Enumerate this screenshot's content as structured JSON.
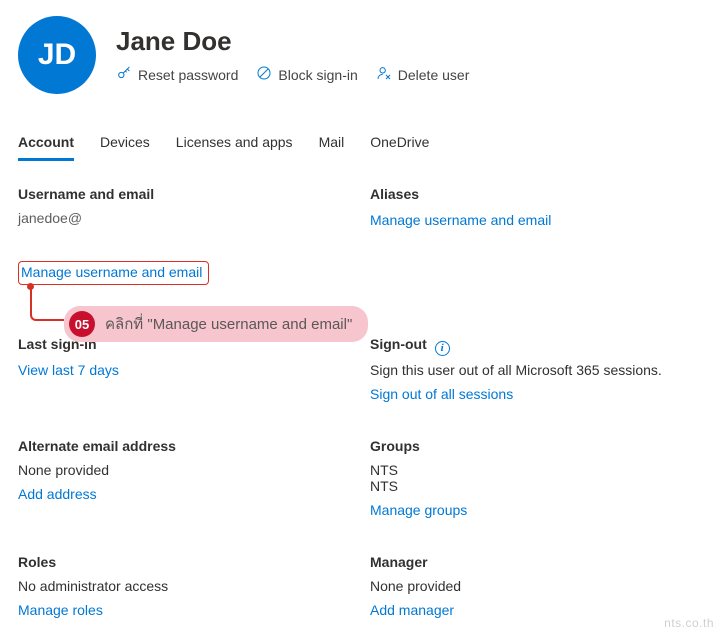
{
  "colors": {
    "primary": "#0078d4",
    "danger": "#d93025"
  },
  "user": {
    "initials": "JD",
    "display_name": "Jane Doe",
    "username_email": "janedoe@"
  },
  "header_actions": {
    "reset_password": "Reset password",
    "block_signin": "Block sign-in",
    "delete_user": "Delete user"
  },
  "tabs": {
    "account": "Account",
    "devices": "Devices",
    "licenses": "Licenses and apps",
    "mail": "Mail",
    "onedrive": "OneDrive",
    "active": "account"
  },
  "sections": {
    "username_email": {
      "heading": "Username and email",
      "link": "Manage username and email"
    },
    "aliases": {
      "heading": "Aliases",
      "link": "Manage username and email"
    },
    "last_signin": {
      "heading": "Last sign-in",
      "link": "View last 7 days"
    },
    "sign_out": {
      "heading": "Sign-out",
      "desc": "Sign this user out of all Microsoft 365 sessions.",
      "link": "Sign out of all sessions"
    },
    "alt_email": {
      "heading": "Alternate email address",
      "value": "None provided",
      "link": "Add address"
    },
    "groups": {
      "heading": "Groups",
      "items": [
        "NTS",
        "NTS"
      ],
      "link": "Manage groups"
    },
    "roles": {
      "heading": "Roles",
      "value": "No administrator access",
      "link": "Manage roles"
    },
    "manager": {
      "heading": "Manager",
      "value": "None provided",
      "link": "Add manager"
    }
  },
  "callout": {
    "step": "05",
    "text": "คลิกที่ \"Manage username and email\""
  },
  "watermark": "nts.co.th"
}
